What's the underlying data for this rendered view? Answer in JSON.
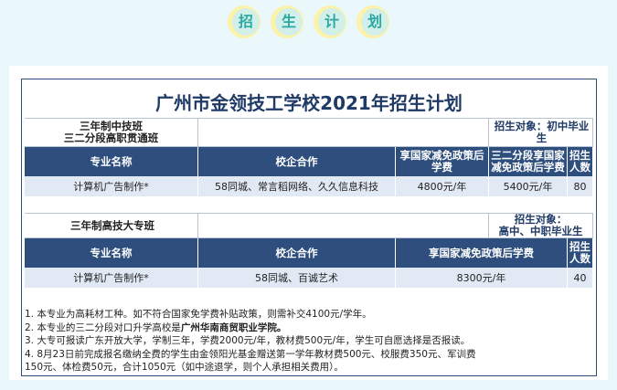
{
  "header_badges": [
    "招",
    "生",
    "计",
    "划"
  ],
  "title": "广州市金领技工学校2021年招生计划",
  "section1": {
    "name_line1": "三年制中技班",
    "name_line2": "三二分段高职贯通班",
    "target": "招生对象：初中毕业生",
    "columns": [
      "专业名称",
      "校企合作",
      "享国家减免政策后学费",
      "三二分段享国家减免政策后学费",
      "招生人数"
    ],
    "rows": [
      {
        "major": "计算机广告制作*",
        "partners": "58同城、常言稻网络、久久信息科技",
        "fee1": "4800元/年",
        "fee2": "5400元/年",
        "count": "80"
      }
    ]
  },
  "section2": {
    "name": "三年制高技大专班",
    "target_line1": "招生对象：",
    "target_line2": "高中、中职毕业生",
    "columns": [
      "专业名称",
      "校企合作",
      "享国家减免政策后学费",
      "招生人数"
    ],
    "rows": [
      {
        "major": "计算机广告制作*",
        "partners": "58同城、百诚艺术",
        "fee": "8300元/年",
        "count": "40"
      }
    ]
  },
  "notes": {
    "n1": "1. 本专业为高耗材工种。如不符合国家免学费补贴政策，则需补交4100元/学年。",
    "n2a": "2. 本专业的三二分段对口升学高校是",
    "n2b": "广州华南商贸职业学院。",
    "n3": "3. 大专可报读广东开放大学，学制三年，学费2000元/年，教材费500元/年，学生可自愿选择是否报读。",
    "n4a": "4. 8月23日前完成报名缴纳全费的学生由金领阳光基金赠送第一学年教材费500元、校服费350元、军训费",
    "n4b": "150元、体检费50元，合计1050元（如中途退学，则个人承担相关费用）。"
  }
}
